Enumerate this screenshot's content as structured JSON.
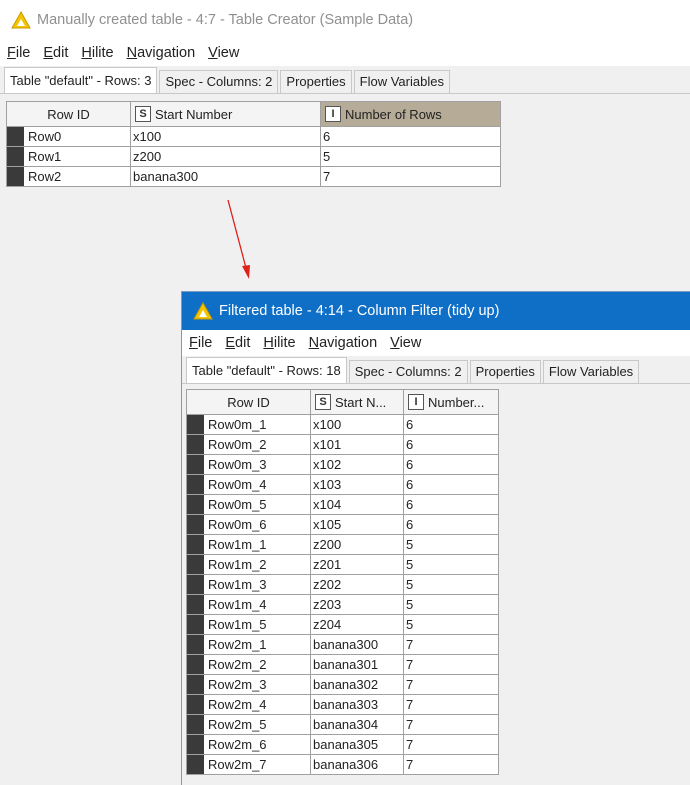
{
  "window1": {
    "title": "Manually created table - 4:7 - Table Creator (Sample Data)",
    "menu": [
      "File",
      "Edit",
      "Hilite",
      "Navigation",
      "View"
    ],
    "tabs": [
      "Table \"default\" - Rows: 3",
      "Spec - Columns: 2",
      "Properties",
      "Flow Variables"
    ],
    "columns": [
      {
        "label": "Row ID",
        "type": ""
      },
      {
        "label": "Start Number",
        "type": "S"
      },
      {
        "label": "Number of Rows",
        "type": "I"
      }
    ],
    "rows": [
      {
        "id": "Row0",
        "start": "x100",
        "count": "6"
      },
      {
        "id": "Row1",
        "start": "z200",
        "count": "5"
      },
      {
        "id": "Row2",
        "start": "banana300",
        "count": "7"
      }
    ]
  },
  "window2": {
    "title": "Filtered table - 4:14 - Column Filter (tidy up)",
    "menu": [
      "File",
      "Edit",
      "Hilite",
      "Navigation",
      "View"
    ],
    "tabs": [
      "Table \"default\" - Rows: 18",
      "Spec - Columns: 2",
      "Properties",
      "Flow Variables"
    ],
    "columns": [
      {
        "label": "Row ID",
        "type": ""
      },
      {
        "label": "Start N...",
        "type": "S"
      },
      {
        "label": "Number...",
        "type": "I"
      }
    ],
    "rows": [
      {
        "id": "Row0m_1",
        "start": "x100",
        "count": "6"
      },
      {
        "id": "Row0m_2",
        "start": "x101",
        "count": "6"
      },
      {
        "id": "Row0m_3",
        "start": "x102",
        "count": "6"
      },
      {
        "id": "Row0m_4",
        "start": "x103",
        "count": "6"
      },
      {
        "id": "Row0m_5",
        "start": "x104",
        "count": "6"
      },
      {
        "id": "Row0m_6",
        "start": "x105",
        "count": "6"
      },
      {
        "id": "Row1m_1",
        "start": "z200",
        "count": "5"
      },
      {
        "id": "Row1m_2",
        "start": "z201",
        "count": "5"
      },
      {
        "id": "Row1m_3",
        "start": "z202",
        "count": "5"
      },
      {
        "id": "Row1m_4",
        "start": "z203",
        "count": "5"
      },
      {
        "id": "Row1m_5",
        "start": "z204",
        "count": "5"
      },
      {
        "id": "Row2m_1",
        "start": "banana300",
        "count": "7"
      },
      {
        "id": "Row2m_2",
        "start": "banana301",
        "count": "7"
      },
      {
        "id": "Row2m_3",
        "start": "banana302",
        "count": "7"
      },
      {
        "id": "Row2m_4",
        "start": "banana303",
        "count": "7"
      },
      {
        "id": "Row2m_5",
        "start": "banana304",
        "count": "7"
      },
      {
        "id": "Row2m_6",
        "start": "banana305",
        "count": "7"
      },
      {
        "id": "Row2m_7",
        "start": "banana306",
        "count": "7"
      }
    ]
  },
  "icons": {
    "app": "knime-triangle-icon",
    "arrow": "red-arrow"
  },
  "colors": {
    "titlebar_active": "#0f6fc6",
    "sorted_header": "#b6ab97",
    "arrow": "#e0201b",
    "icon_yellow": "#f5c400"
  }
}
